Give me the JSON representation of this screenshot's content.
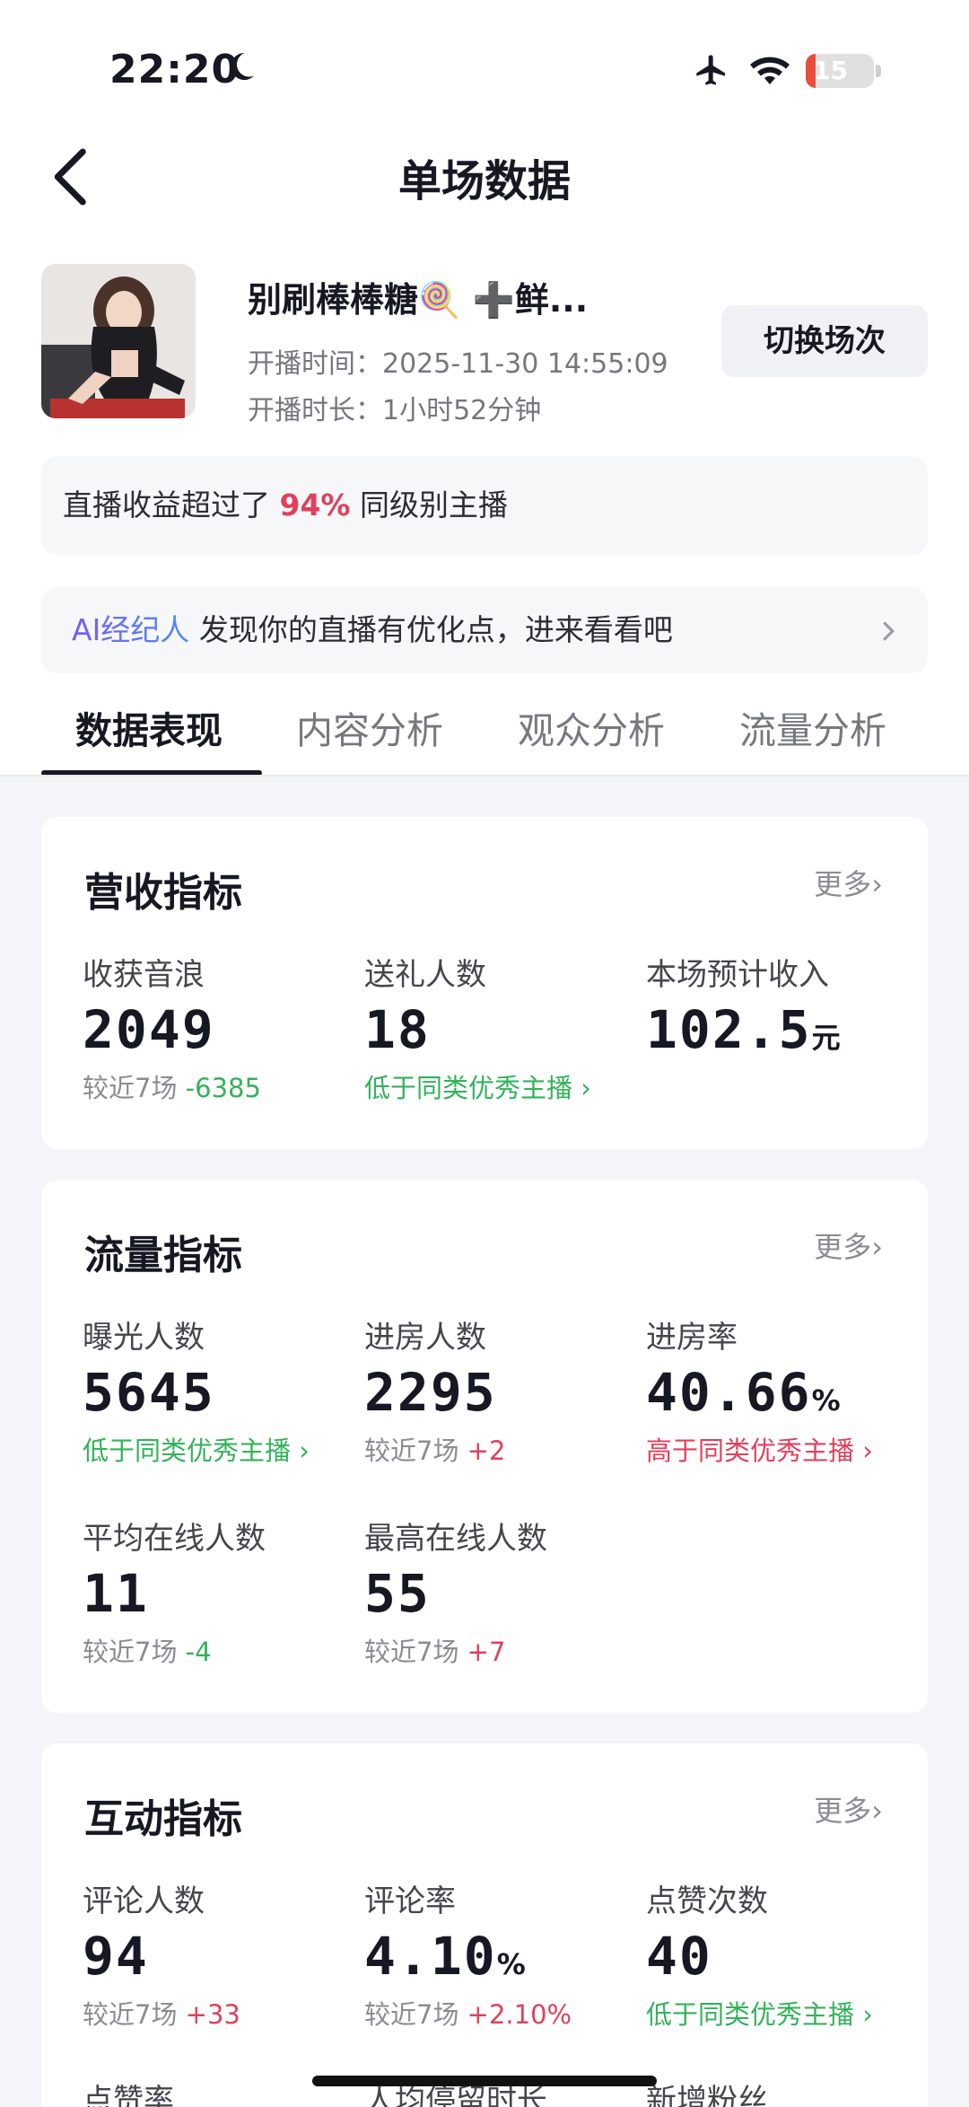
{
  "status_bar": {
    "time": "22:20",
    "battery_level": "15",
    "battery_fraction": 0.15
  },
  "header": {
    "title": "单场数据"
  },
  "stream": {
    "name": "别刷棒棒糖🍭 ➕鲜...",
    "start_time_label": "开播时间：",
    "start_time": "2025-11-30 14:55:09",
    "duration_label": "开播时长：",
    "duration": "1小时52分钟",
    "switch_button": "切换场次"
  },
  "ranking_bar": {
    "prefix": "直播收益超过了",
    "percent": "94%",
    "suffix": "同级别主播"
  },
  "ai_bar": {
    "ai_label": "AI经纪人",
    "text": "发现你的直播有优化点，进来看看吧"
  },
  "tabs": [
    "数据表现",
    "内容分析",
    "观众分析",
    "流量分析"
  ],
  "active_tab": 0,
  "sections": {
    "revenue": {
      "title": "营收指标",
      "more": "更多",
      "metrics": [
        {
          "label": "收获音浪",
          "value": "2049",
          "unit": "",
          "sub_prefix": "较近7场",
          "sub_value": "-6385"
        },
        {
          "label": "送礼人数",
          "value": "18",
          "unit": "",
          "sub_text": "低于同类优秀主播"
        },
        {
          "label": "本场预计收入",
          "value": "102.5",
          "unit": "元"
        }
      ]
    },
    "traffic": {
      "title": "流量指标",
      "more": "更多",
      "metrics": [
        {
          "label": "曝光人数",
          "value": "5645",
          "unit": "",
          "sub_text": "低于同类优秀主播"
        },
        {
          "label": "进房人数",
          "value": "2295",
          "unit": "",
          "sub_prefix": "较近7场",
          "sub_value": "+2"
        },
        {
          "label": "进房率",
          "value": "40.66",
          "unit": "%",
          "sub_text": "高于同类优秀主播"
        },
        {
          "label": "平均在线人数",
          "value": "11",
          "unit": "",
          "sub_prefix": "较近7场",
          "sub_value": "-4"
        },
        {
          "label": "最高在线人数",
          "value": "55",
          "unit": "",
          "sub_prefix": "较近7场",
          "sub_value": "+7"
        }
      ]
    },
    "interaction": {
      "title": "互动指标",
      "more": "更多",
      "metrics": [
        {
          "label": "评论人数",
          "value": "94",
          "unit": "",
          "sub_prefix": "较近7场",
          "sub_value": "+33"
        },
        {
          "label": "评论率",
          "value": "4.10",
          "unit": "%",
          "sub_prefix": "较近7场",
          "sub_value": "+2.10%"
        },
        {
          "label": "点赞次数",
          "value": "40",
          "unit": "",
          "sub_text": "低于同类优秀主播"
        },
        {
          "label": "点赞率"
        },
        {
          "label": "人均停留时长"
        },
        {
          "label": "新增粉丝"
        }
      ]
    }
  },
  "colors": {
    "accent_red": "#e0405c",
    "accent_green": "#34b25a",
    "ai_purple": "#7b5cf0",
    "ai_blue": "#4d8df6"
  }
}
